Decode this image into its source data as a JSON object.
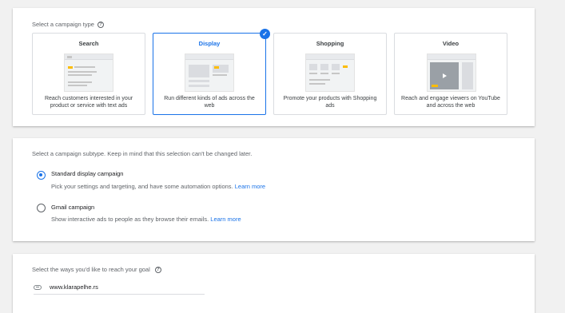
{
  "type_section": {
    "title": "Select a campaign type",
    "cards": [
      {
        "title": "Search",
        "desc": "Reach customers interested in your product or service with text ads"
      },
      {
        "title": "Display",
        "desc": "Run different kinds of ads across the web"
      },
      {
        "title": "Shopping",
        "desc": "Promote your products with Shopping ads"
      },
      {
        "title": "Video",
        "desc": "Reach and engage viewers on YouTube and across the web"
      }
    ],
    "selected": "Display"
  },
  "subtype_section": {
    "title": "Select a campaign subtype. Keep in mind that this selection can't be changed later.",
    "options": [
      {
        "title": "Standard display campaign",
        "desc": "Pick your settings and targeting, and have some automation options.",
        "link": "Learn more"
      },
      {
        "title": "Gmail campaign",
        "desc": "Show interactive ads to people as they browse their emails.",
        "link": "Learn more"
      }
    ]
  },
  "goal_section": {
    "title": "Select the ways you'd like to reach your goal",
    "url": "www.klarapelhe.rs"
  },
  "colors": {
    "accent": "#1a73e8",
    "highlight": "#fbbc04"
  },
  "icons": {
    "help": "?",
    "check": "✓"
  }
}
